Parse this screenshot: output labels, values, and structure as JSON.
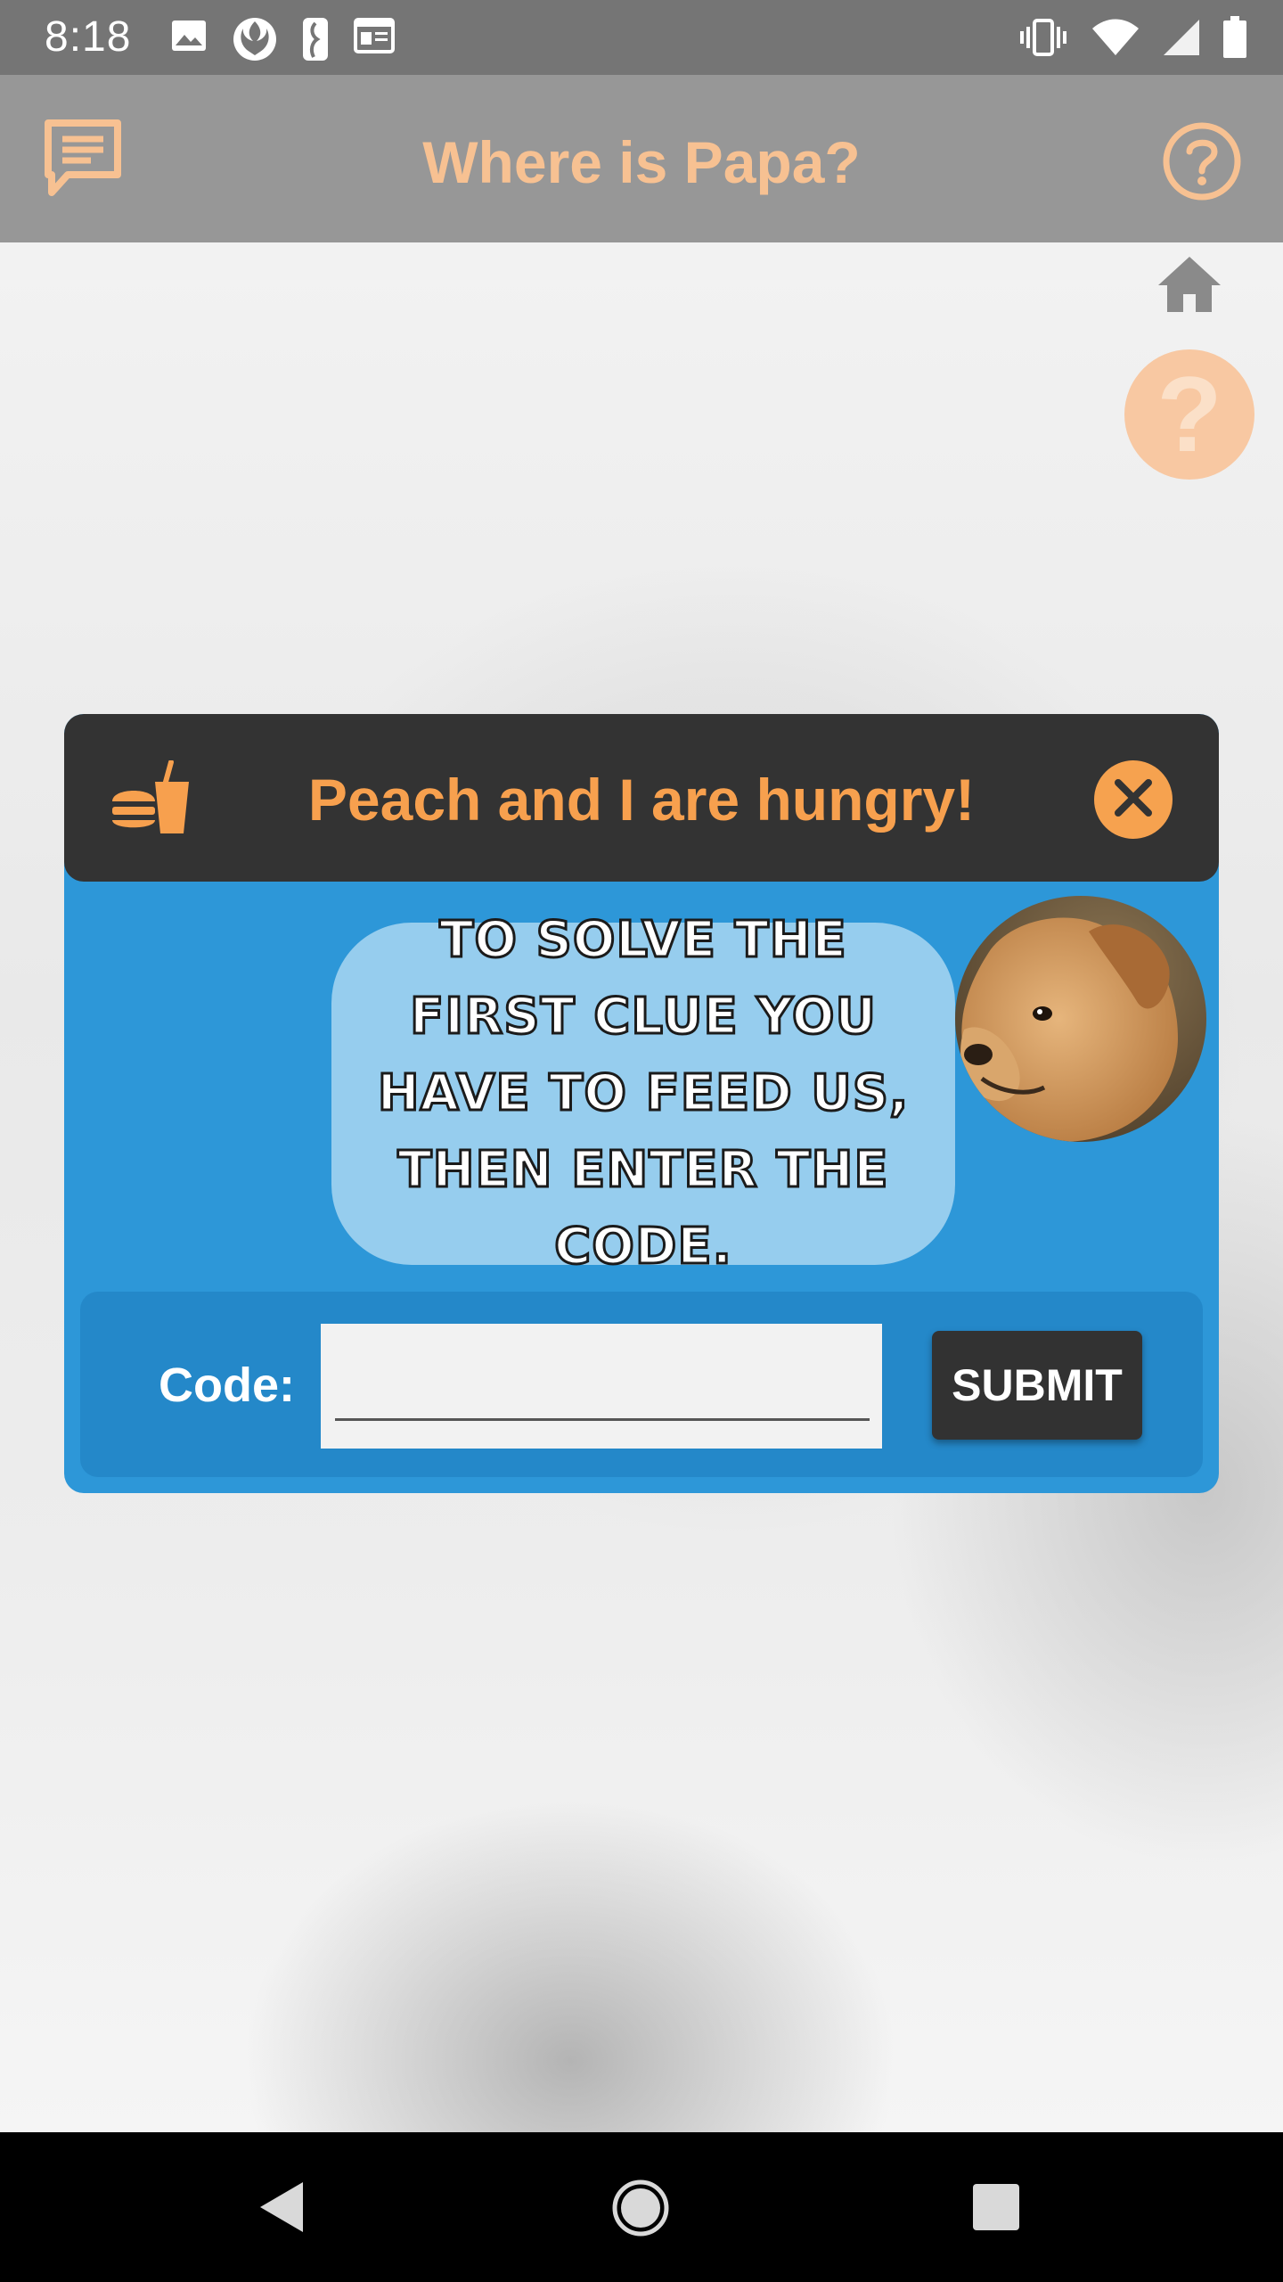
{
  "status_bar": {
    "time": "8:18",
    "left_icons": [
      "image-icon",
      "rebel-icon",
      "nba-icon",
      "news-icon"
    ],
    "right_icons": [
      "vibrate-icon",
      "wifi-icon",
      "signal-icon",
      "battery-icon"
    ]
  },
  "app_bar": {
    "title": "Where is Papa?",
    "left_icon": "chat-icon",
    "right_icon": "help-icon",
    "title_color": "#f7c192",
    "background": "#979797"
  },
  "floating": {
    "home_icon": "home-icon",
    "help_glyph": "?"
  },
  "dialog": {
    "title": "Peach and I are hungry!",
    "title_icon": "food-drink-icon",
    "close_icon": "close-icon",
    "message": "To solve the first clue you have to feed us, then enter the code.",
    "avatar": "puppy-photo",
    "code_label": "Code:",
    "code_value": "",
    "submit_label": "SUBMIT",
    "colors": {
      "header": "#333333",
      "body": "#2d97d8",
      "accent": "#f7a04e",
      "bubble": "#96cdee"
    }
  },
  "nav_bar": {
    "back_icon": "back-icon",
    "home_icon": "home-circle-icon",
    "recent_icon": "recent-apps-icon"
  }
}
